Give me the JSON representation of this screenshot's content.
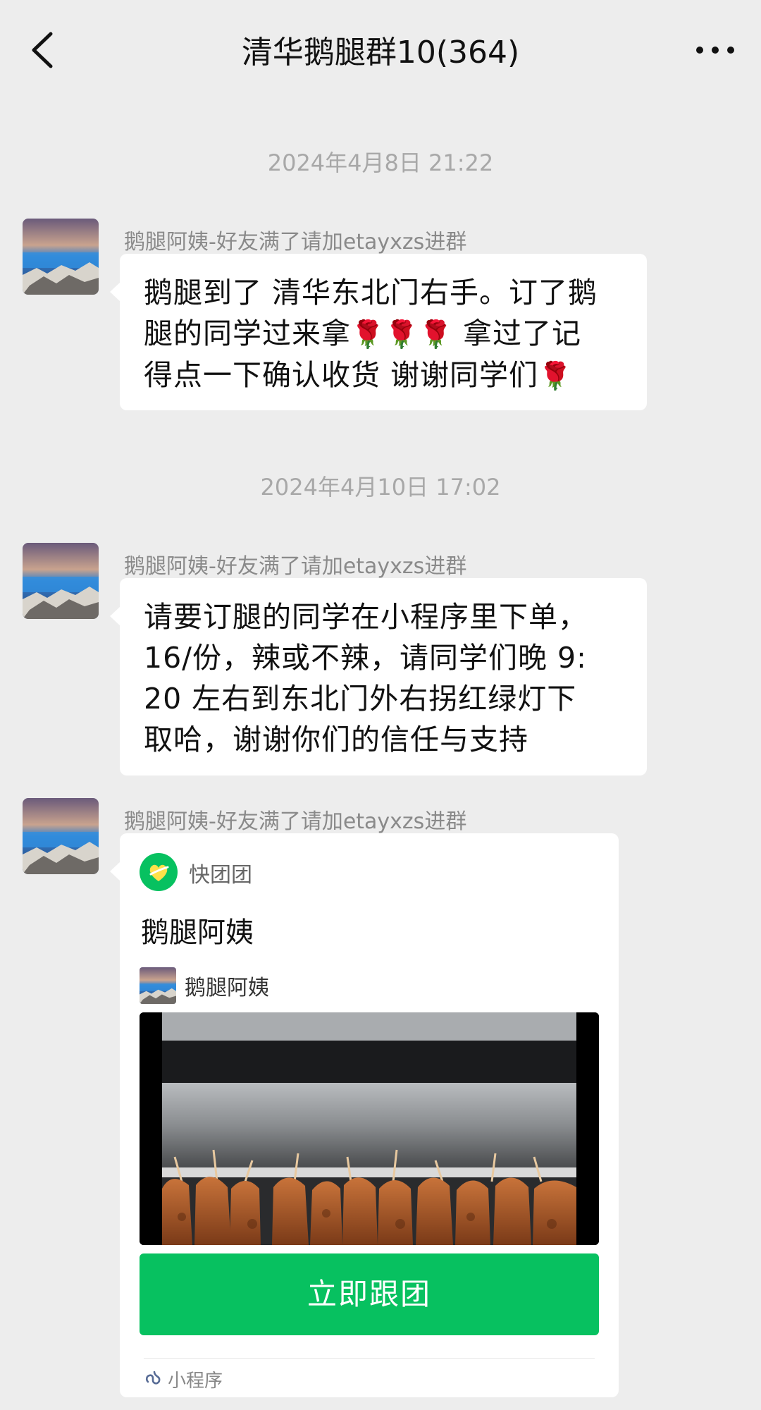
{
  "header": {
    "title": "清华鹅腿群10(364)",
    "back_icon": "chevron-left-icon",
    "more_icon": "more-dots-icon"
  },
  "messages": [
    {
      "timestamp": "2024年4月8日 21:22",
      "sender": "鹅腿阿姨-好友满了请加etayxzs进群",
      "lines": [
        "鹅腿到了 清华东北门右手。订了鹅",
        "腿的同学过来拿",
        " 拿过了记",
        "得点一下确认收货 谢谢同学们"
      ],
      "emoji": "🌹"
    },
    {
      "timestamp": "2024年4月10日 17:02",
      "sender": "鹅腿阿姨-好友满了请加etayxzs进群",
      "lines": [
        "请要订腿的同学在小程序里下单，",
        "16/份，辣或不辣，请同学们晚 9:",
        "20 左右到东北门外右拐红绿灯下",
        "取哈，谢谢你们的信任与支持"
      ]
    },
    {
      "sender": "鹅腿阿姨-好友满了请加etayxzs进群"
    }
  ],
  "mini_program_card": {
    "app_name": "快团团",
    "title": "鹅腿阿姨",
    "seller_name": "鹅腿阿姨",
    "button_label": "立即跟团",
    "footer_label": "小程序",
    "accent_color": "#07c160"
  },
  "colors": {
    "background": "#ededed",
    "bubble": "#ffffff",
    "timestamp": "#a8a8a8",
    "sender": "#8a8a8a"
  }
}
